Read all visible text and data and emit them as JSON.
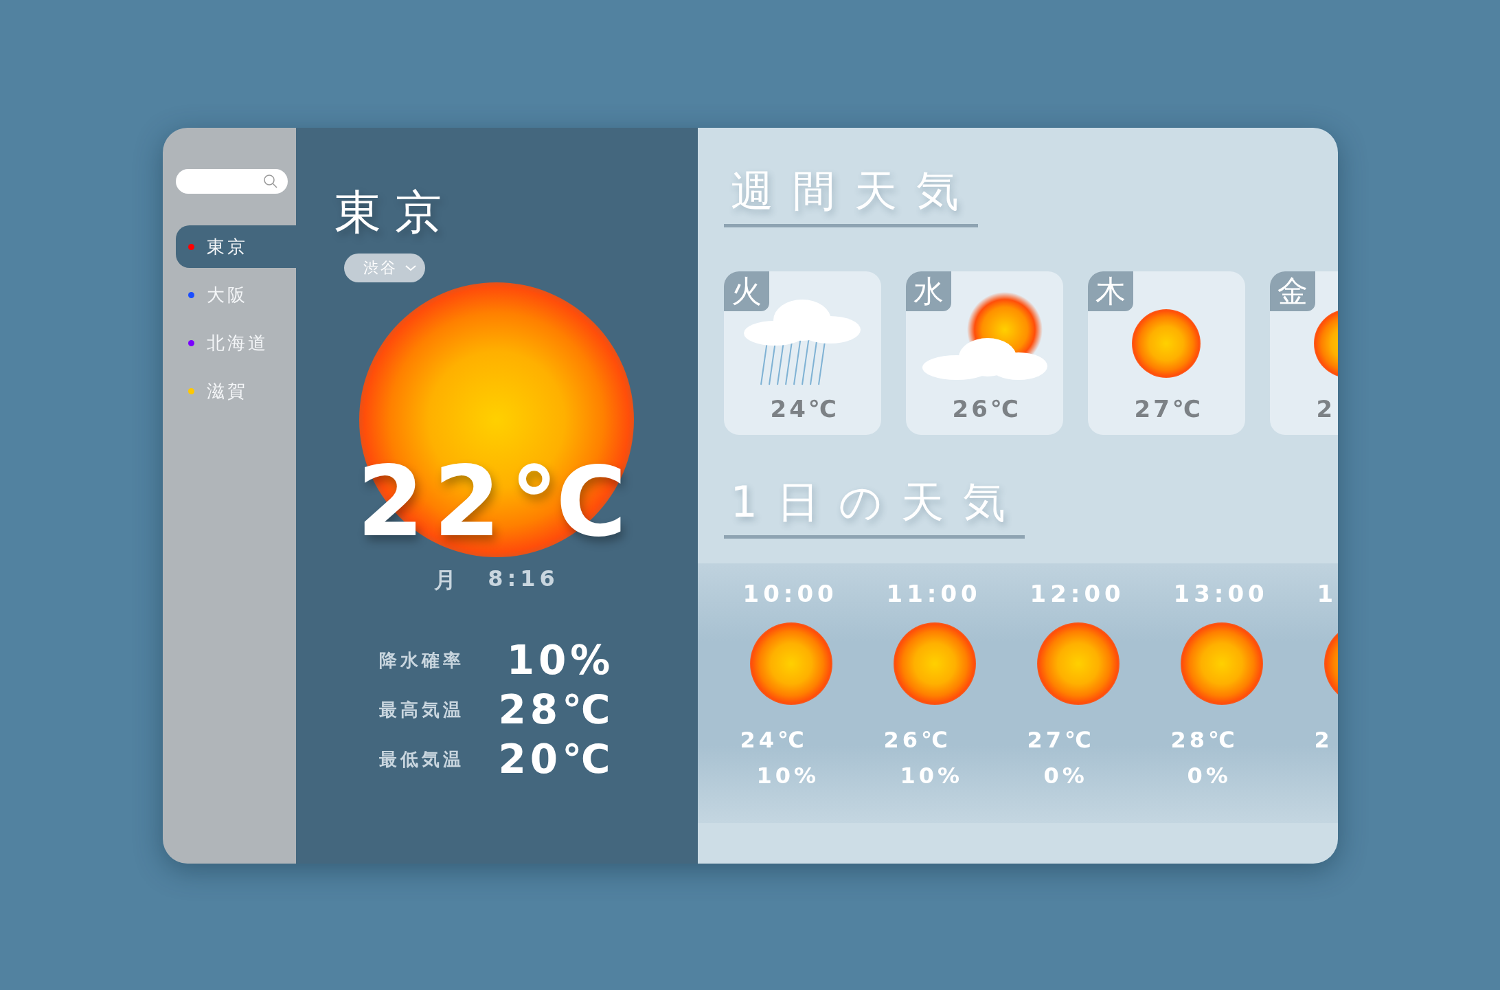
{
  "sidebar": {
    "items": [
      {
        "label": "東京",
        "color": "#ff0000",
        "selected": true
      },
      {
        "label": "大阪",
        "color": "#1a4dff",
        "selected": false
      },
      {
        "label": "北海道",
        "color": "#7a00ff",
        "selected": false
      },
      {
        "label": "滋賀",
        "color": "#ffc800",
        "selected": false
      }
    ]
  },
  "current": {
    "city": "東京",
    "district": "渋谷",
    "kind": "sun",
    "temperature": "22℃",
    "day": "月",
    "time": "8:16",
    "stats": [
      {
        "label": "降水確率",
        "value": "10%"
      },
      {
        "label": "最高気温",
        "value": "28℃"
      },
      {
        "label": "最低気温",
        "value": "20℃"
      }
    ]
  },
  "weekly": {
    "title": "週間天気",
    "days": [
      {
        "day": "火",
        "kind": "rain",
        "temperature": "24℃"
      },
      {
        "day": "水",
        "kind": "partly-cloudy",
        "temperature": "26℃"
      },
      {
        "day": "木",
        "kind": "sun",
        "temperature": "27℃"
      },
      {
        "day": "金",
        "kind": "sun",
        "temperature": "2"
      }
    ]
  },
  "hourly": {
    "title": "1日の天気",
    "hours": [
      {
        "time": "10:00",
        "kind": "sun",
        "temperature": "24℃",
        "precipitation": "10%"
      },
      {
        "time": "11:00",
        "kind": "sun",
        "temperature": "26℃",
        "precipitation": "10%"
      },
      {
        "time": "12:00",
        "kind": "sun",
        "temperature": "27℃",
        "precipitation": "0%"
      },
      {
        "time": "13:00",
        "kind": "sun",
        "temperature": "28℃",
        "precipitation": "0%"
      },
      {
        "time": "1",
        "kind": "sun",
        "temperature": "2"
      }
    ]
  }
}
